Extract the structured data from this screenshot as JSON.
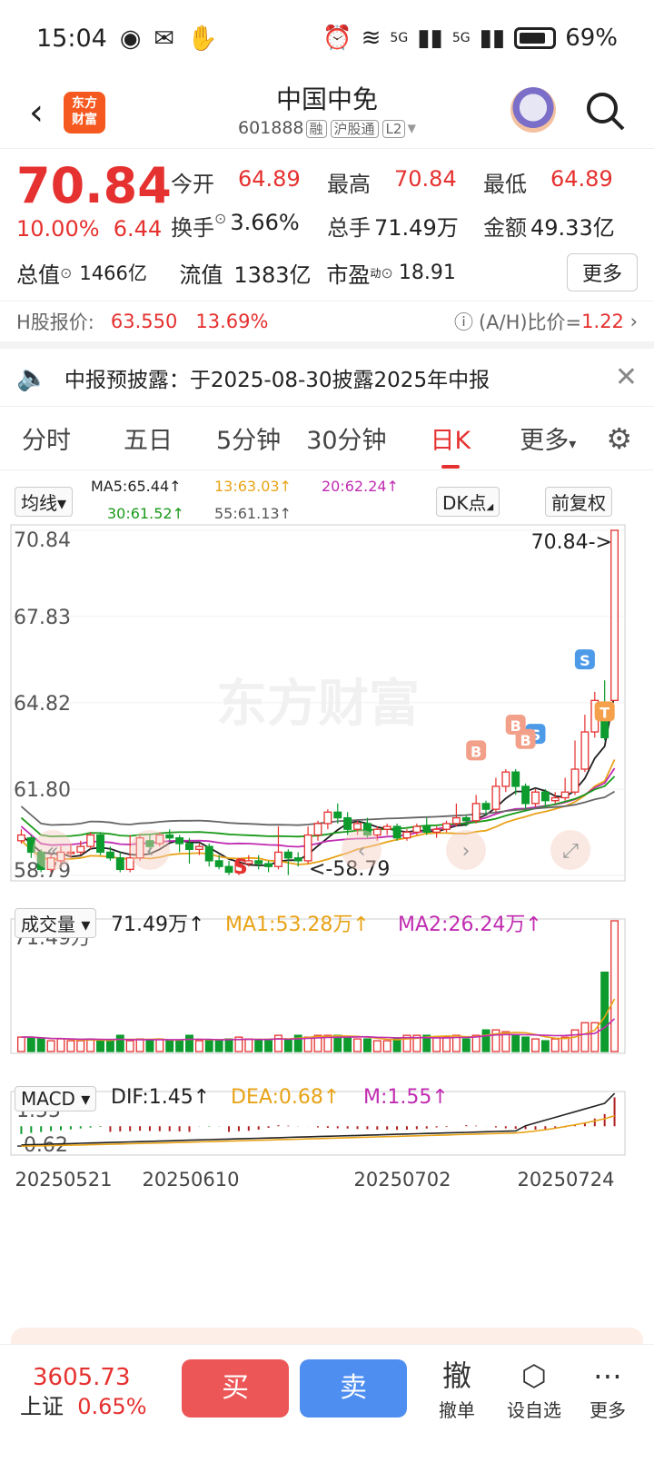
{
  "status_bar": {
    "time": "15:04",
    "battery": "69%",
    "signal1": "5G",
    "signal2": "5G"
  },
  "header": {
    "logo_text": "东方财富",
    "title": "中国中免",
    "code": "601888",
    "tags": [
      "融",
      "沪股通",
      "L2"
    ]
  },
  "quote": {
    "price": "70.84",
    "change_pct": "10.00%",
    "change": "6.44",
    "open_label": "今开",
    "open": "64.89",
    "high_label": "最高",
    "high": "70.84",
    "low_label": "最低",
    "low": "64.89",
    "turnover_label": "换手",
    "turnover": "3.66%",
    "volume_label": "总手",
    "volume": "71.49万",
    "amount_label": "金额",
    "amount": "49.33亿",
    "mktcap_label": "总值",
    "mktcap": "1466亿",
    "float_label": "流值",
    "float": "1383亿",
    "pe_label": "市盈",
    "pe_sup": "动",
    "pe": "18.91",
    "more_label": "更多"
  },
  "hshare": {
    "label": "H股报价:",
    "price": "63.550",
    "pct": "13.69%",
    "ah_label": "(A/H)比价=",
    "ah_value": "1.22"
  },
  "notice": {
    "text": "中报预披露：于2025-08-30披露2025年中报"
  },
  "tabs": [
    "分时",
    "五日",
    "5分钟",
    "30分钟",
    "日K",
    "更多"
  ],
  "active_tab": "日K",
  "ma_bar": {
    "selector": "均线",
    "ma5": "MA5:65.44↑",
    "ma13": "13:63.03↑",
    "ma20": "20:62.24↑",
    "ma30": "30:61.52↑",
    "ma55": "55:61.13↑",
    "dk": "DK点",
    "adjust": "前复权"
  },
  "kline_labels": {
    "y": [
      "70.84",
      "67.83",
      "64.82",
      "61.80",
      "58.79"
    ],
    "max_note": "70.84->",
    "min_note": "<-58.79",
    "watermark": "东方财富"
  },
  "volume_bar": {
    "selector": "成交量",
    "value": "71.49万↑",
    "ma1": "MA1:53.28万↑",
    "ma2": "MA2:26.24万↑",
    "y_max": "71.49万"
  },
  "macd_bar": {
    "selector": "MACD",
    "dif": "DIF:1.45↑",
    "dea": "DEA:0.68↑",
    "m": "M:1.55↑",
    "y_max": "1.55",
    "y_min": "-0.62"
  },
  "x_labels": [
    "20250521",
    "20250610",
    "20250702",
    "20250724"
  ],
  "chart_data": {
    "type": "candlestick",
    "ylim": [
      58.79,
      70.84
    ],
    "candles": [
      [
        60.0,
        60.2,
        60.4,
        59.9
      ],
      [
        60.1,
        59.6,
        60.2,
        59.4
      ],
      [
        59.6,
        59.0,
        59.7,
        58.9
      ],
      [
        59.0,
        59.4,
        59.6,
        58.9
      ],
      [
        59.3,
        59.6,
        59.8,
        59.2
      ],
      [
        59.6,
        59.6,
        59.9,
        59.4
      ],
      [
        59.6,
        59.8,
        60.0,
        59.5
      ],
      [
        59.8,
        60.2,
        60.3,
        59.7
      ],
      [
        60.2,
        59.6,
        60.3,
        59.5
      ],
      [
        59.6,
        59.4,
        59.8,
        59.3
      ],
      [
        59.4,
        59.0,
        59.6,
        58.9
      ],
      [
        59.0,
        59.4,
        60.2,
        58.9
      ],
      [
        59.4,
        60.1,
        60.2,
        59.3
      ],
      [
        60.0,
        59.8,
        60.2,
        59.6
      ],
      [
        59.9,
        60.2,
        60.3,
        59.8
      ],
      [
        60.2,
        60.1,
        60.4,
        60.0
      ],
      [
        60.1,
        59.9,
        60.2,
        59.6
      ],
      [
        59.9,
        59.7,
        60.1,
        59.2
      ],
      [
        59.7,
        59.8,
        59.9,
        59.5
      ],
      [
        59.8,
        59.3,
        59.9,
        59.1
      ],
      [
        59.3,
        59.1,
        59.5,
        59.0
      ],
      [
        59.1,
        58.9,
        59.3,
        58.8
      ],
      [
        58.9,
        59.2,
        59.4,
        58.8
      ],
      [
        59.2,
        59.3,
        59.5,
        59.1
      ],
      [
        59.3,
        59.2,
        59.5,
        59.0
      ],
      [
        59.2,
        59.1,
        59.3,
        58.9
      ],
      [
        59.1,
        59.6,
        60.5,
        59.0
      ],
      [
        59.6,
        59.4,
        59.7,
        58.8
      ],
      [
        59.4,
        59.3,
        59.6,
        59.1
      ],
      [
        59.3,
        60.2,
        60.5,
        59.2
      ],
      [
        60.2,
        60.6,
        60.7,
        60.0
      ],
      [
        60.6,
        61.0,
        61.1,
        60.4
      ],
      [
        61.0,
        60.8,
        61.3,
        60.6
      ],
      [
        60.8,
        60.4,
        61.0,
        60.2
      ],
      [
        60.4,
        60.6,
        60.7,
        60.2
      ],
      [
        60.6,
        60.2,
        60.8,
        60.1
      ],
      [
        60.2,
        60.4,
        60.5,
        60.0
      ],
      [
        60.4,
        60.5,
        60.6,
        60.2
      ],
      [
        60.5,
        60.1,
        60.6,
        60.0
      ],
      [
        60.1,
        60.3,
        60.4,
        60.0
      ],
      [
        60.3,
        60.5,
        60.6,
        60.2
      ],
      [
        60.5,
        60.3,
        60.8,
        60.2
      ],
      [
        60.3,
        60.4,
        60.5,
        60.1
      ],
      [
        60.4,
        60.6,
        60.7,
        60.3
      ],
      [
        60.6,
        60.8,
        61.3,
        60.5
      ],
      [
        60.8,
        60.7,
        60.9,
        60.5
      ],
      [
        60.7,
        61.3,
        61.6,
        60.6
      ],
      [
        61.3,
        61.1,
        61.4,
        60.9
      ],
      [
        61.1,
        61.9,
        62.2,
        61.0
      ],
      [
        61.9,
        62.4,
        62.5,
        61.7
      ],
      [
        62.4,
        61.9,
        62.5,
        61.6
      ],
      [
        61.9,
        61.3,
        62.0,
        61.1
      ],
      [
        61.3,
        61.7,
        61.8,
        61.2
      ],
      [
        61.7,
        61.4,
        61.8,
        61.2
      ],
      [
        61.4,
        61.5,
        61.7,
        61.3
      ],
      [
        61.5,
        61.7,
        62.2,
        61.4
      ],
      [
        61.7,
        62.5,
        63.5,
        61.6
      ],
      [
        62.5,
        63.8,
        64.4,
        62.4
      ],
      [
        63.8,
        64.9,
        65.2,
        63.6
      ],
      [
        64.8,
        63.6,
        65.6,
        63.5
      ],
      [
        64.9,
        70.84,
        70.84,
        64.89
      ]
    ],
    "volume_max": 71.49,
    "volumes": [
      8,
      8,
      7,
      6,
      7,
      6,
      6,
      7,
      6,
      6,
      9,
      6,
      7,
      6,
      7,
      6,
      6,
      9,
      6,
      6,
      6,
      7,
      8,
      7,
      6,
      6,
      9,
      7,
      9,
      8,
      9,
      9,
      9,
      8,
      7,
      7,
      6,
      6,
      7,
      9,
      9,
      9,
      8,
      8,
      9,
      7,
      9,
      12,
      12,
      11,
      9,
      8,
      7,
      6,
      7,
      8,
      12,
      16,
      16,
      44,
      58
    ],
    "macd": [
      -0.35,
      -0.3,
      -0.26,
      -0.22,
      -0.18,
      -0.14,
      -0.1,
      -0.06,
      -0.03,
      0.0,
      0.02,
      0.03,
      0.05,
      0.04,
      0.03,
      0.03,
      0.02,
      0.0,
      -0.01,
      -0.02,
      -0.01,
      0.0,
      0.03,
      0.05,
      0.1,
      0.18,
      0.3,
      0.28,
      0.26,
      0.25,
      0.2,
      0.18,
      0.16,
      0.15,
      0.13,
      0.12,
      0.1,
      0.1,
      0.09,
      0.1,
      0.12,
      0.15,
      0.2,
      0.22,
      0.25,
      0.3,
      0.28,
      0.25,
      0.2,
      0.16,
      0.14,
      0.12,
      0.1,
      0.1,
      0.15,
      0.2,
      0.3,
      0.4,
      0.6,
      0.8,
      1.55
    ],
    "markers": [
      {
        "t": "B",
        "i": 46
      },
      {
        "t": "S",
        "i": 52
      },
      {
        "t": "B",
        "i": 51
      },
      {
        "t": "B",
        "i": 50
      },
      {
        "t": "S",
        "i": 57
      },
      {
        "t": "T",
        "i": 59
      },
      {
        "t": "S",
        "i": 22
      }
    ]
  },
  "bottom": {
    "index_value": "3605.73",
    "index_name": "上证",
    "index_pct": "0.65%",
    "buy": "买",
    "sell": "卖",
    "cancel_glyph": "撤",
    "cancel": "撤单",
    "watch": "设自选",
    "more": "更多"
  }
}
